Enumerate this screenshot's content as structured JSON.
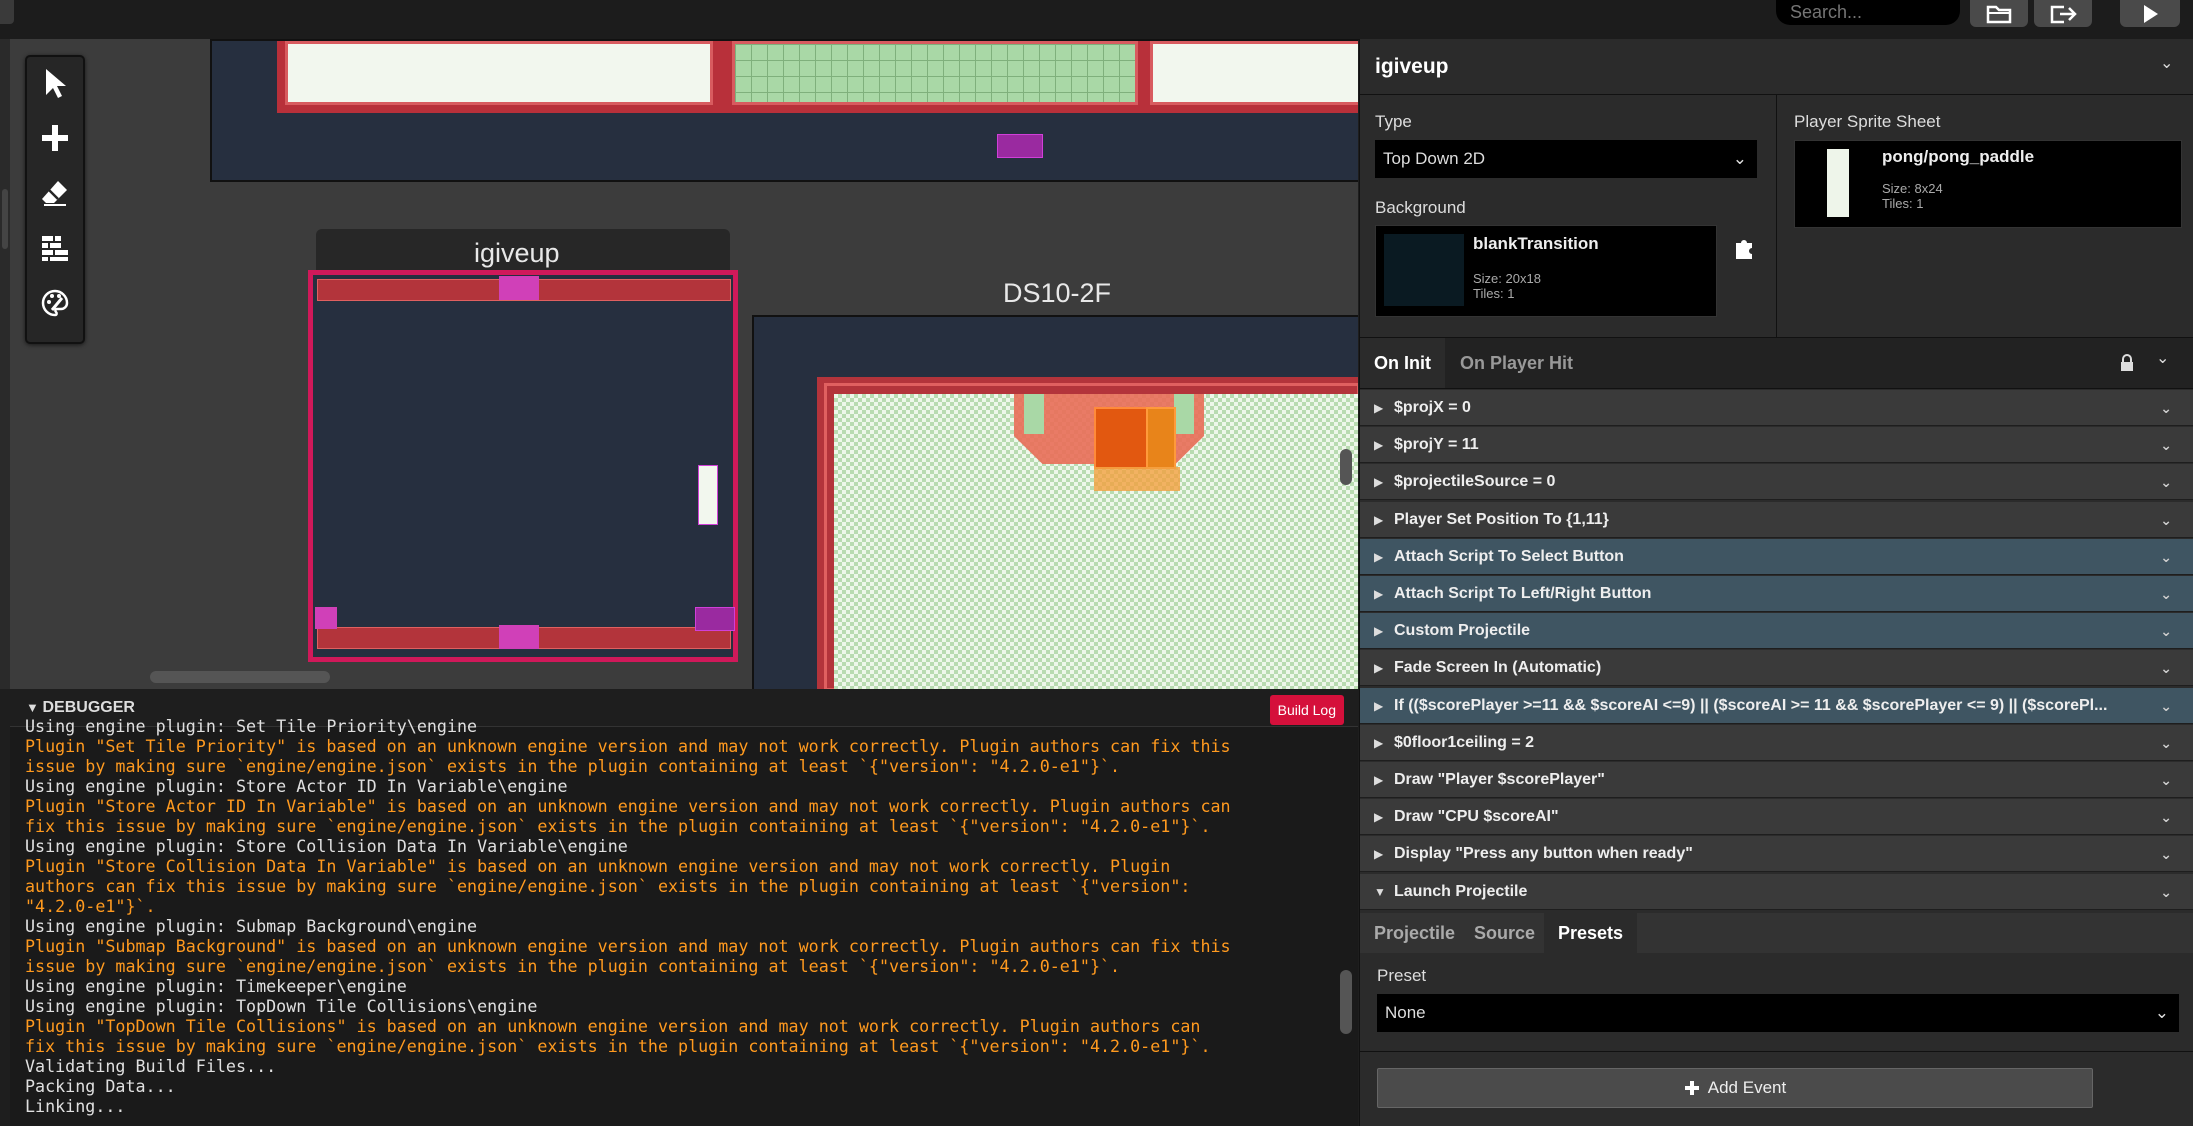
{
  "topbar": {
    "search_placeholder": "Search..."
  },
  "icons": {
    "select": "cursor-arrow-icon",
    "add": "plus-icon",
    "erase": "eraser-icon",
    "collisions": "bricks-icon",
    "colorize": "palette-icon"
  },
  "canvas": {
    "scene_left_title": "igiveup",
    "scene_right_title": "DS10-2F"
  },
  "scene": {
    "name": "igiveup",
    "type_label": "Type",
    "type_value": "Top Down 2D",
    "background_label": "Background",
    "background": {
      "name": "blankTransition",
      "size_text": "Size:  20x18",
      "tiles_text": "Tiles:  1"
    },
    "sprite_label": "Player Sprite Sheet",
    "sprite": {
      "name": "pong/pong_paddle",
      "size_text": "Size:  8x24",
      "tiles_text": "Tiles:  1"
    }
  },
  "script_tabs": [
    "On Init",
    "On Player Hit"
  ],
  "events": [
    {
      "label": "$projX = 0",
      "style": "plain"
    },
    {
      "label": "$projY = 11",
      "style": "plain"
    },
    {
      "label": "$projectileSource = 0",
      "style": "plain"
    },
    {
      "label": "Player Set Position To {1,11}",
      "style": "plain"
    },
    {
      "label": "Attach Script To Select Button",
      "style": "blue"
    },
    {
      "label": "Attach Script To Left/Right Button",
      "style": "blue"
    },
    {
      "label": "Custom Projectile",
      "style": "blue"
    },
    {
      "label": "Fade Screen In (Automatic)",
      "style": "plain"
    },
    {
      "label": "If (($scorePlayer >=11 && $scoreAI <=9) || ($scoreAI >= 11 && $scorePlayer <= 9) || ($scorePl...",
      "style": "blue"
    },
    {
      "label": "$0floor1ceiling = 2",
      "style": "plain"
    },
    {
      "label": "Draw \"Player $scorePlayer\"",
      "style": "plain"
    },
    {
      "label": "Draw \"CPU $scoreAI\"",
      "style": "plain"
    },
    {
      "label": "Display \"Press any button when ready\"",
      "style": "plain"
    },
    {
      "label": "Launch Projectile",
      "style": "plain"
    }
  ],
  "launch_tabs": [
    "Projectile",
    "Source",
    "Presets"
  ],
  "preset": {
    "label": "Preset",
    "value": "None"
  },
  "add_event_label": "Add Event",
  "debugger": {
    "title": "DEBUGGER",
    "build_log_label": "Build Log",
    "lines": [
      {
        "t": "Using engine plugin: Set Tile Priority\\engine",
        "k": "n"
      },
      {
        "t": "Plugin \"Set Tile Priority\" is based on an unknown engine version and may not work correctly. Plugin authors can fix this",
        "k": "w"
      },
      {
        "t": "issue by making sure `engine/engine.json` exists in the plugin containing at least `{\"version\": \"4.2.0-e1\"}`.",
        "k": "w"
      },
      {
        "t": "Using engine plugin: Store Actor ID In Variable\\engine",
        "k": "n"
      },
      {
        "t": "Plugin \"Store Actor ID In Variable\" is based on an unknown engine version and may not work correctly. Plugin authors can",
        "k": "w"
      },
      {
        "t": "fix this issue by making sure `engine/engine.json` exists in the plugin containing at least `{\"version\": \"4.2.0-e1\"}`.",
        "k": "w"
      },
      {
        "t": "Using engine plugin: Store Collision Data In Variable\\engine",
        "k": "n"
      },
      {
        "t": "Plugin \"Store Collision Data In Variable\" is based on an unknown engine version and may not work correctly. Plugin",
        "k": "w"
      },
      {
        "t": "authors can fix this issue by making sure `engine/engine.json` exists in the plugin containing at least `{\"version\":",
        "k": "w"
      },
      {
        "t": "\"4.2.0-e1\"}`.",
        "k": "w"
      },
      {
        "t": "Using engine plugin: Submap Background\\engine",
        "k": "n"
      },
      {
        "t": "Plugin \"Submap Background\" is based on an unknown engine version and may not work correctly. Plugin authors can fix this",
        "k": "w"
      },
      {
        "t": "issue by making sure `engine/engine.json` exists in the plugin containing at least `{\"version\": \"4.2.0-e1\"}`.",
        "k": "w"
      },
      {
        "t": "Using engine plugin: Timekeeper\\engine",
        "k": "n"
      },
      {
        "t": "Using engine plugin: TopDown Tile Collisions\\engine",
        "k": "n"
      },
      {
        "t": "Plugin \"TopDown Tile Collisions\" is based on an unknown engine version and may not work correctly. Plugin authors can",
        "k": "w"
      },
      {
        "t": "fix this issue by making sure `engine/engine.json` exists in the plugin containing at least `{\"version\": \"4.2.0-e1\"}`.",
        "k": "w"
      },
      {
        "t": "Validating Build Files...",
        "k": "n"
      },
      {
        "t": "Packing Data...",
        "k": "n"
      },
      {
        "t": "Linking...",
        "k": "n"
      }
    ]
  },
  "colors": {
    "accent_red": "#d5103b",
    "warning_orange": "#ff9a1f",
    "event_blue": "#3f5562"
  }
}
